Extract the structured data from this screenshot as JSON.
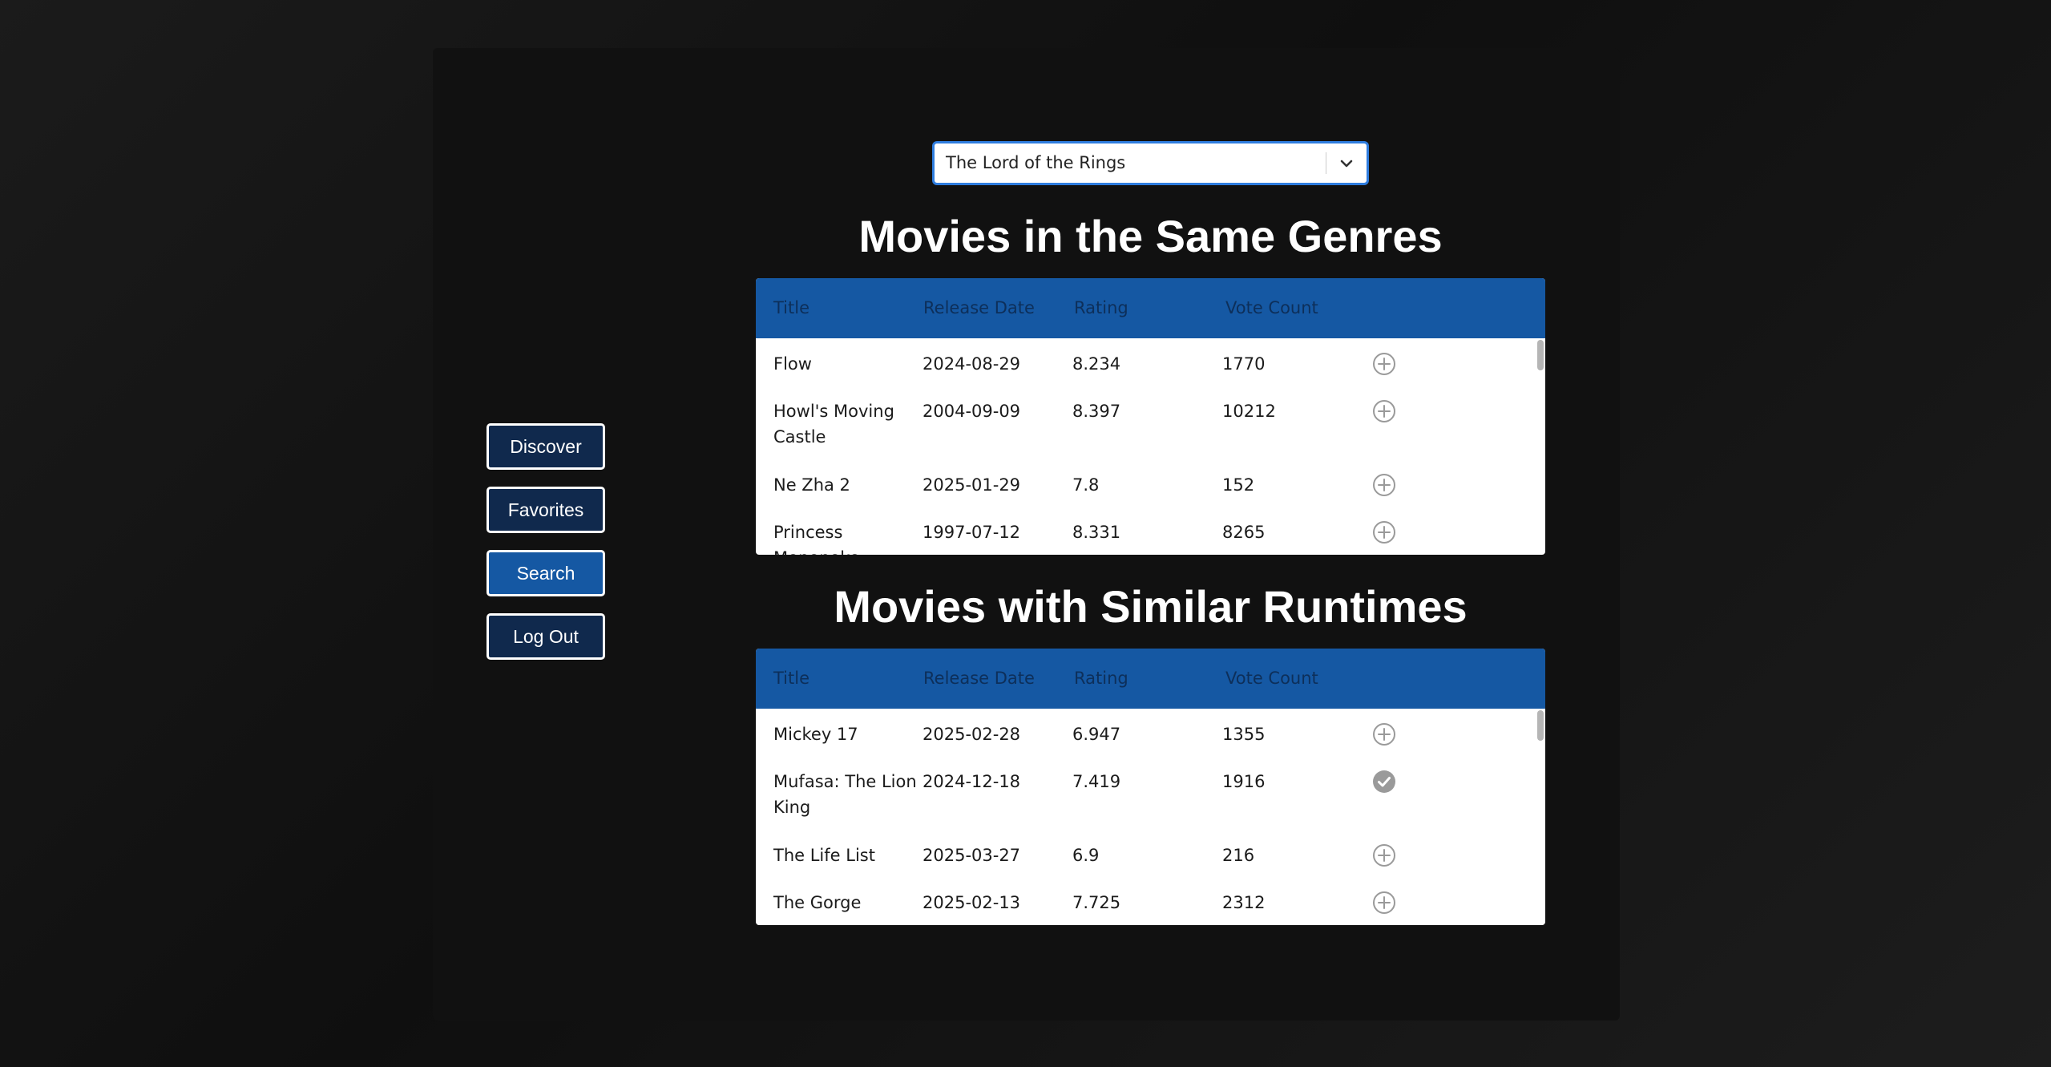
{
  "nav": {
    "discover": "Discover",
    "favorites": "Favorites",
    "search": "Search",
    "logout": "Log Out"
  },
  "movie_select": {
    "value": "The Lord of the Rings"
  },
  "columns": {
    "title": "Title",
    "release_date": "Release Date",
    "rating": "Rating",
    "vote_count": "Vote Count"
  },
  "same_genres": {
    "heading": "Movies in the Same Genres",
    "rows": [
      {
        "title": "Flow",
        "release_date": "2024-08-29",
        "rating": "8.234",
        "vote_count": "1770",
        "action": "add-icon"
      },
      {
        "title": "Howl's Moving Castle",
        "release_date": "2004-09-09",
        "rating": "8.397",
        "vote_count": "10212",
        "action": "add-icon"
      },
      {
        "title": "Ne Zha 2",
        "release_date": "2025-01-29",
        "rating": "7.8",
        "vote_count": "152",
        "action": "add-icon"
      },
      {
        "title": "Princess Mononoke",
        "release_date": "1997-07-12",
        "rating": "8.331",
        "vote_count": "8265",
        "action": "add-icon"
      }
    ]
  },
  "similar_runtimes": {
    "heading": "Movies with Similar Runtimes",
    "rows": [
      {
        "title": "Mickey 17",
        "release_date": "2025-02-28",
        "rating": "6.947",
        "vote_count": "1355",
        "action": "add-icon"
      },
      {
        "title": "Mufasa: The Lion King",
        "release_date": "2024-12-18",
        "rating": "7.419",
        "vote_count": "1916",
        "action": "check-icon"
      },
      {
        "title": "The Life List",
        "release_date": "2025-03-27",
        "rating": "6.9",
        "vote_count": "216",
        "action": "add-icon"
      },
      {
        "title": "The Gorge",
        "release_date": "2025-02-13",
        "rating": "7.725",
        "vote_count": "2312",
        "action": "add-icon"
      }
    ]
  },
  "colors": {
    "header_blue": "#1558a3",
    "nav_dark": "#10294d",
    "nav_active": "#1558a3",
    "icon_gray": "#9a9a9a"
  }
}
